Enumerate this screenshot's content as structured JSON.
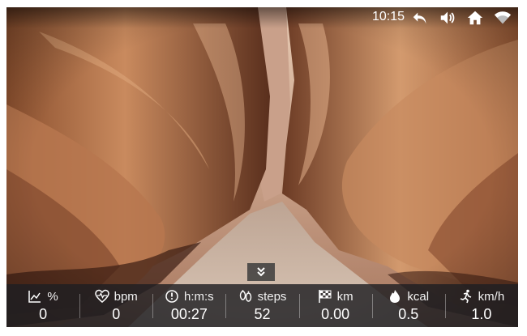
{
  "status_bar": {
    "time": "10:15",
    "icons": [
      "back-arrow-icon",
      "volume-icon",
      "home-icon",
      "wifi-icon"
    ]
  },
  "colors": {
    "metrics_bar_bg": "#1e1e22",
    "text": "#ffffff",
    "rock_light": "#c98a5e",
    "rock_dark": "#4a2416",
    "sand": "#cdb7a4"
  },
  "expand_button": {
    "icon": "chevron-double-down-icon"
  },
  "metrics": [
    {
      "key": "incline",
      "icon": "incline-chart-icon",
      "unit": "%",
      "value": "0"
    },
    {
      "key": "heart_rate",
      "icon": "heart-pulse-icon",
      "unit": "bpm",
      "value": "0"
    },
    {
      "key": "time",
      "icon": "timer-icon",
      "unit": "h:m:s",
      "value": "00:27"
    },
    {
      "key": "steps",
      "icon": "footprints-icon",
      "unit": "steps",
      "value": "52"
    },
    {
      "key": "distance",
      "icon": "checkered-flag-icon",
      "unit": "km",
      "value": "0.00"
    },
    {
      "key": "calories",
      "icon": "flame-icon",
      "unit": "kcal",
      "value": "0.5"
    },
    {
      "key": "speed",
      "icon": "runner-icon",
      "unit": "km/h",
      "value": "1.0"
    }
  ]
}
